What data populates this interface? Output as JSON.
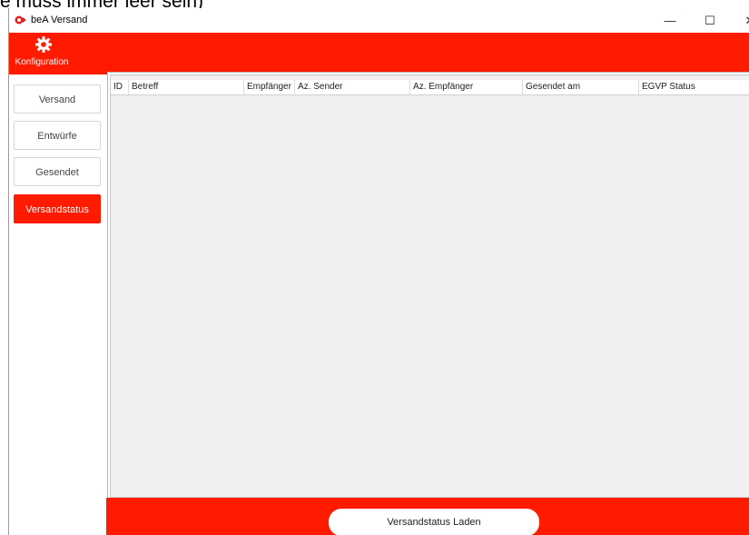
{
  "background_text": "e muss immer leer sein)",
  "window": {
    "title": "beA Versand"
  },
  "window_controls": {
    "minimize": "—",
    "maximize": "☐",
    "close": "✕"
  },
  "topbar": {
    "config_label": "Konfiguration",
    "icon": "gear-icon"
  },
  "sidebar": {
    "items": [
      {
        "label": "Versand"
      },
      {
        "label": "Entwürfe"
      },
      {
        "label": "Gesendet"
      },
      {
        "label": "Versandstatus",
        "active": true
      }
    ]
  },
  "table": {
    "columns": [
      "ID",
      "Betreff",
      "Empfänger",
      "Az. Sender",
      "Az. Empfänger",
      "Gesendet am",
      "EGVP Status"
    ],
    "rows": []
  },
  "footer": {
    "load_button": "Versandstatus Laden"
  },
  "colors": {
    "accent": "#ff1a00",
    "grid_bg": "#f0f0f0"
  }
}
